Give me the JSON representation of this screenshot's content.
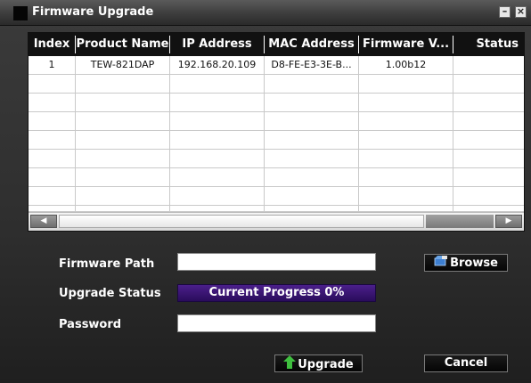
{
  "window": {
    "title": "Firmware Upgrade",
    "minimize_glyph": "–",
    "close_glyph": "×"
  },
  "table": {
    "columns": [
      "Index",
      "Product Name",
      "IP Address",
      "MAC Address",
      "Firmware V...",
      "Status"
    ],
    "rows": [
      [
        "1",
        "TEW-821DAP",
        "192.168.20.109",
        "D8-FE-E3-3E-B...",
        "1.00b12",
        ""
      ],
      [
        "",
        "",
        "",
        "",
        "",
        ""
      ],
      [
        "",
        "",
        "",
        "",
        "",
        ""
      ],
      [
        "",
        "",
        "",
        "",
        "",
        ""
      ],
      [
        "",
        "",
        "",
        "",
        "",
        ""
      ],
      [
        "",
        "",
        "",
        "",
        "",
        ""
      ],
      [
        "",
        "",
        "",
        "",
        "",
        ""
      ],
      [
        "",
        "",
        "",
        "",
        "",
        ""
      ],
      [
        "",
        "",
        "",
        "",
        "",
        ""
      ]
    ],
    "scroll_left_glyph": "◀",
    "scroll_right_glyph": "▶"
  },
  "form": {
    "firmware_path_label": "Firmware Path",
    "firmware_path_value": "",
    "upgrade_status_label": "Upgrade Status",
    "progress_text": "Current Progress 0%",
    "progress_value": 0,
    "password_label": "Password",
    "password_value": ""
  },
  "buttons": {
    "browse": "Browse",
    "upgrade": "Upgrade",
    "cancel": "Cancel"
  },
  "icons": {
    "browse": "folder-icon",
    "upgrade": "up-arrow-icon"
  },
  "colors": {
    "progress_bg": "#3a1670",
    "upgrade_arrow": "#3fbf3f"
  }
}
